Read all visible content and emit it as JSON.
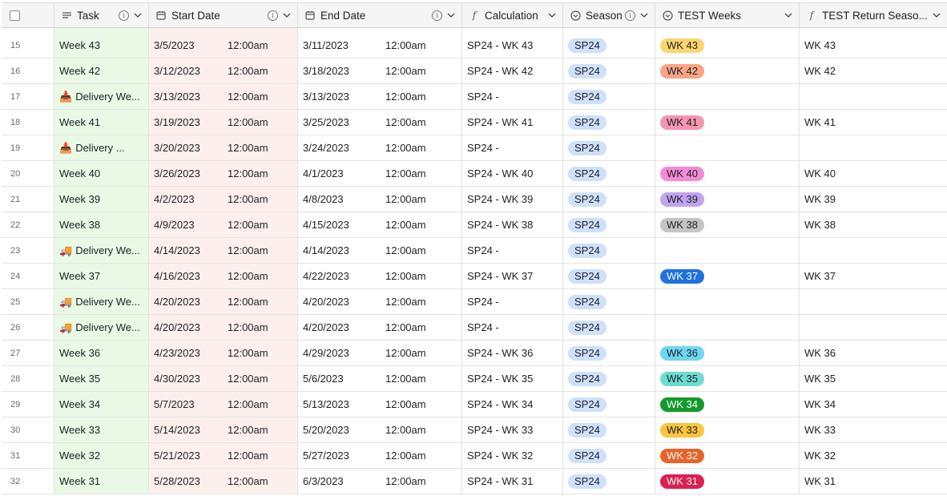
{
  "columns": {
    "task": "Task",
    "start": "Start Date",
    "end": "End Date",
    "calc": "Calculation",
    "season": "Season",
    "test": "TEST Weeks",
    "ret": "TEST Return Seaso..."
  },
  "icons": {
    "task_type": "long-text-icon",
    "date_type": "calendar-icon",
    "formula_type": "formula-icon",
    "select_type": "single-select-icon",
    "info": "info-icon",
    "chevron": "chevron-down-icon",
    "delivery_truck": "delivery-truck-emoji",
    "delivery_inbox": "inbox-tray-emoji"
  },
  "colors": {
    "task_bg": "#e9f9e6",
    "start_bg": "#fdf0ec",
    "season_pill": "#cfe0fb"
  },
  "rows": [
    {
      "num": "15",
      "task": "Week 43",
      "emoji": "",
      "start_date": "3/5/2023",
      "start_time": "12:00am",
      "end_date": "3/11/2023",
      "end_time": "12:00am",
      "calc": "SP24 - WK 43",
      "season": "SP24",
      "week": "WK 43",
      "week_bg": "#fcd66d",
      "week_fg": "#1d1f25",
      "ret": "WK 43"
    },
    {
      "num": "16",
      "task": "Week 42",
      "emoji": "",
      "start_date": "3/12/2023",
      "start_time": "12:00am",
      "end_date": "3/18/2023",
      "end_time": "12:00am",
      "calc": "SP24 - WK 42",
      "season": "SP24",
      "week": "WK 42",
      "week_bg": "#f7a583",
      "week_fg": "#1d1f25",
      "ret": "WK 42"
    },
    {
      "num": "17",
      "task": "Delivery We...",
      "emoji": "📥",
      "start_date": "3/13/2023",
      "start_time": "12:00am",
      "end_date": "3/13/2023",
      "end_time": "12:00am",
      "calc": "SP24 -",
      "season": "SP24",
      "week": "",
      "week_bg": "",
      "week_fg": "",
      "ret": ""
    },
    {
      "num": "18",
      "task": "Week 41",
      "emoji": "",
      "start_date": "3/19/2023",
      "start_time": "12:00am",
      "end_date": "3/25/2023",
      "end_time": "12:00am",
      "calc": "SP24 - WK 41",
      "season": "SP24",
      "week": "WK 41",
      "week_bg": "#f594ae",
      "week_fg": "#1d1f25",
      "ret": "WK 41"
    },
    {
      "num": "19",
      "task": "Delivery ...",
      "emoji": "📥",
      "start_date": "3/20/2023",
      "start_time": "12:00am",
      "end_date": "3/24/2023",
      "end_time": "12:00am",
      "calc": "SP24 -",
      "season": "SP24",
      "week": "",
      "week_bg": "",
      "week_fg": "",
      "ret": ""
    },
    {
      "num": "20",
      "task": "Week 40",
      "emoji": "",
      "start_date": "3/26/2023",
      "start_time": "12:00am",
      "end_date": "4/1/2023",
      "end_time": "12:00am",
      "calc": "SP24 - WK 40",
      "season": "SP24",
      "week": "WK 40",
      "week_bg": "#f58ad6",
      "week_fg": "#1d1f25",
      "ret": "WK 40"
    },
    {
      "num": "21",
      "task": "Week 39",
      "emoji": "",
      "start_date": "4/2/2023",
      "start_time": "12:00am",
      "end_date": "4/8/2023",
      "end_time": "12:00am",
      "calc": "SP24 - WK 39",
      "season": "SP24",
      "week": "WK 39",
      "week_bg": "#c2a3ee",
      "week_fg": "#1d1f25",
      "ret": "WK 39"
    },
    {
      "num": "22",
      "task": "Week 38",
      "emoji": "",
      "start_date": "4/9/2023",
      "start_time": "12:00am",
      "end_date": "4/15/2023",
      "end_time": "12:00am",
      "calc": "SP24 - WK 38",
      "season": "SP24",
      "week": "WK 38",
      "week_bg": "#c4c4c4",
      "week_fg": "#1d1f25",
      "ret": "WK 38"
    },
    {
      "num": "23",
      "task": "Delivery We...",
      "emoji": "🚚",
      "start_date": "4/14/2023",
      "start_time": "12:00am",
      "end_date": "4/14/2023",
      "end_time": "12:00am",
      "calc": "SP24 -",
      "season": "SP24",
      "week": "",
      "week_bg": "",
      "week_fg": "",
      "ret": ""
    },
    {
      "num": "24",
      "task": "Week 37",
      "emoji": "",
      "start_date": "4/16/2023",
      "start_time": "12:00am",
      "end_date": "4/22/2023",
      "end_time": "12:00am",
      "calc": "SP24 - WK 37",
      "season": "SP24",
      "week": "WK 37",
      "week_bg": "#1f72e0",
      "week_fg": "#ffffff",
      "ret": "WK 37"
    },
    {
      "num": "25",
      "task": "Delivery We...",
      "emoji": "🚚",
      "start_date": "4/20/2023",
      "start_time": "12:00am",
      "end_date": "4/20/2023",
      "end_time": "12:00am",
      "calc": "SP24 -",
      "season": "SP24",
      "week": "",
      "week_bg": "",
      "week_fg": "",
      "ret": ""
    },
    {
      "num": "26",
      "task": "Delivery We...",
      "emoji": "🚚",
      "start_date": "4/20/2023",
      "start_time": "12:00am",
      "end_date": "4/20/2023",
      "end_time": "12:00am",
      "calc": "SP24 -",
      "season": "SP24",
      "week": "",
      "week_bg": "",
      "week_fg": "",
      "ret": ""
    },
    {
      "num": "27",
      "task": "Week 36",
      "emoji": "",
      "start_date": "4/23/2023",
      "start_time": "12:00am",
      "end_date": "4/29/2023",
      "end_time": "12:00am",
      "calc": "SP24 - WK 36",
      "season": "SP24",
      "week": "WK 36",
      "week_bg": "#6fd6ef",
      "week_fg": "#1d1f25",
      "ret": "WK 36"
    },
    {
      "num": "28",
      "task": "Week 35",
      "emoji": "",
      "start_date": "4/30/2023",
      "start_time": "12:00am",
      "end_date": "5/6/2023",
      "end_time": "12:00am",
      "calc": "SP24 - WK 35",
      "season": "SP24",
      "week": "WK 35",
      "week_bg": "#6fdbd0",
      "week_fg": "#1d1f25",
      "ret": "WK 35"
    },
    {
      "num": "29",
      "task": "Week 34",
      "emoji": "",
      "start_date": "5/7/2023",
      "start_time": "12:00am",
      "end_date": "5/13/2023",
      "end_time": "12:00am",
      "calc": "SP24 - WK 34",
      "season": "SP24",
      "week": "WK 34",
      "week_bg": "#129a2c",
      "week_fg": "#ffffff",
      "ret": "WK 34"
    },
    {
      "num": "30",
      "task": "Week 33",
      "emoji": "",
      "start_date": "5/14/2023",
      "start_time": "12:00am",
      "end_date": "5/20/2023",
      "end_time": "12:00am",
      "calc": "SP24 - WK 33",
      "season": "SP24",
      "week": "WK 33",
      "week_bg": "#fcc43c",
      "week_fg": "#1d1f25",
      "ret": "WK 33"
    },
    {
      "num": "31",
      "task": "Week 32",
      "emoji": "",
      "start_date": "5/21/2023",
      "start_time": "12:00am",
      "end_date": "5/27/2023",
      "end_time": "12:00am",
      "calc": "SP24 - WK 32",
      "season": "SP24",
      "week": "WK 32",
      "week_bg": "#e8632b",
      "week_fg": "#ffffff",
      "ret": "WK 32"
    },
    {
      "num": "32",
      "task": "Week 31",
      "emoji": "",
      "start_date": "5/28/2023",
      "start_time": "12:00am",
      "end_date": "6/3/2023",
      "end_time": "12:00am",
      "calc": "SP24 - WK 31",
      "season": "SP24",
      "week": "WK 31",
      "week_bg": "#dc1f4f",
      "week_fg": "#ffffff",
      "ret": "WK 31"
    }
  ]
}
